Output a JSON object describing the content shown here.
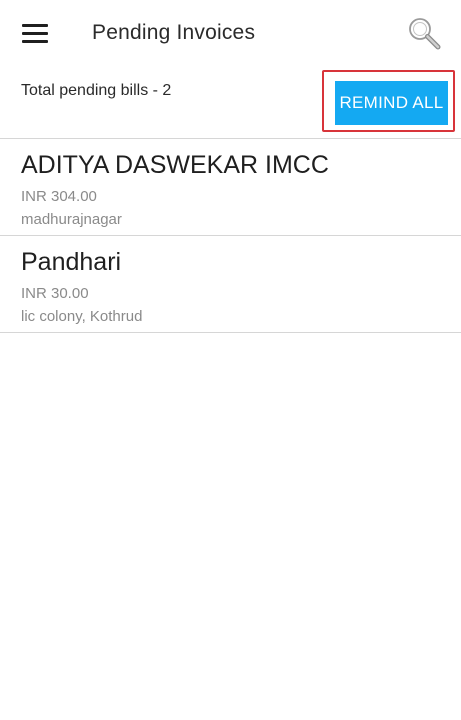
{
  "appbar": {
    "title": "Pending Invoices",
    "menu_icon": "hamburger-menu-icon",
    "search_icon": "search-icon"
  },
  "summary": {
    "text": "Total pending bills - 2",
    "remind_all_label": "REMIND ALL",
    "accent_color": "#14a9f2",
    "highlight_color": "#d8343a"
  },
  "invoices": [
    {
      "name": "ADITYA DASWEKAR IMCC",
      "amount": "INR 304.00",
      "address": "madhurajnagar"
    },
    {
      "name": "Pandhari",
      "amount": "INR 30.00",
      "address": "lic colony, Kothrud"
    }
  ]
}
